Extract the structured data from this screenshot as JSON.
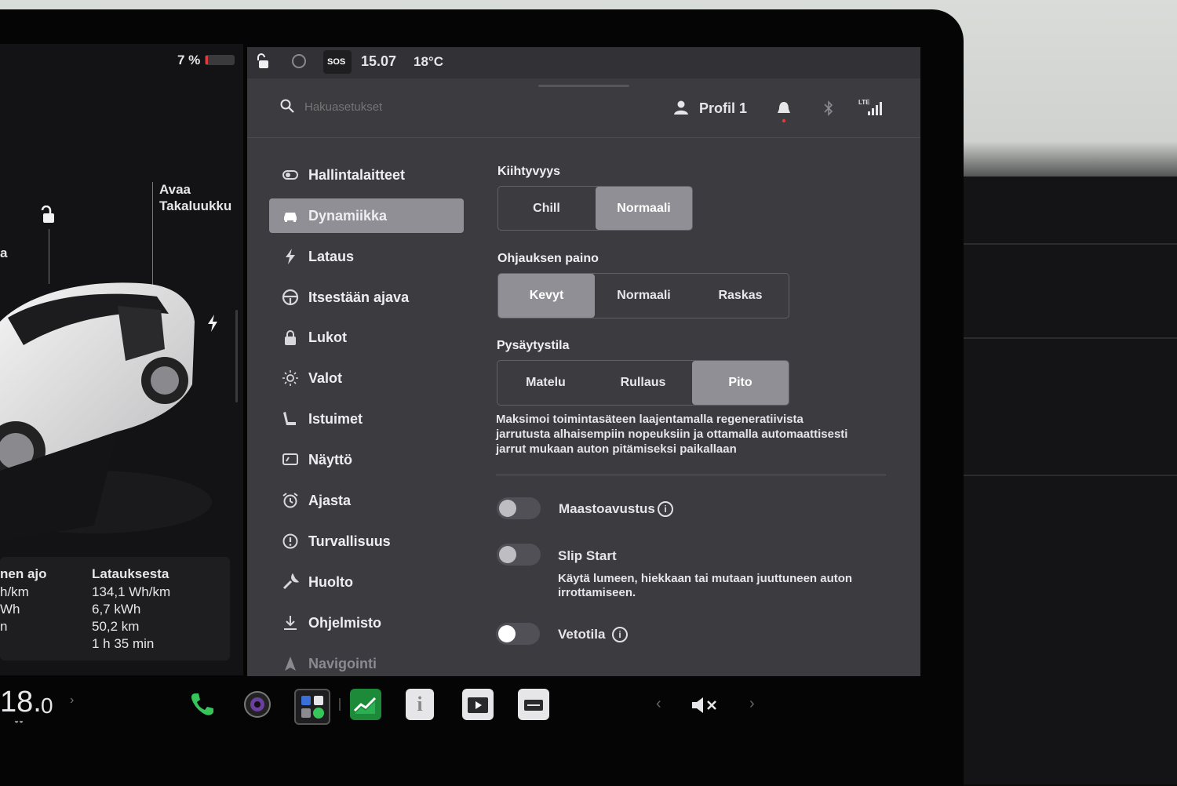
{
  "status": {
    "battery_percent": "7 %",
    "battery_level": 0.07,
    "sos_label": "SOS",
    "time": "15.07",
    "temperature": "18°C"
  },
  "car_panel": {
    "trunk_label_line1": "Avaa",
    "trunk_label_line2": "Takaluukku",
    "left_edge_letter": "a",
    "stats_left_header": "nen ajo",
    "stats_left_values": [
      "h/km",
      "Wh",
      "n"
    ],
    "stats_right_header": "Latauksesta",
    "stats_right_values": [
      "134,1 Wh/km",
      "6,7 kWh",
      "50,2 km",
      "1 h 35 min"
    ]
  },
  "header": {
    "search_placeholder": "Hakuasetukset",
    "profile_label": "Profil 1",
    "network_label": "LTE"
  },
  "sidebar": {
    "items": [
      {
        "label": "Hallintalaitteet",
        "icon": "toggle-icon"
      },
      {
        "label": "Dynamiikka",
        "icon": "car-icon",
        "active": true
      },
      {
        "label": "Lataus",
        "icon": "bolt-icon"
      },
      {
        "label": "Itsestään ajava",
        "icon": "steering-wheel-icon"
      },
      {
        "label": "Lukot",
        "icon": "lock-icon"
      },
      {
        "label": "Valot",
        "icon": "sun-icon"
      },
      {
        "label": "Istuimet",
        "icon": "seat-icon"
      },
      {
        "label": "Näyttö",
        "icon": "display-icon"
      },
      {
        "label": "Ajasta",
        "icon": "alarm-clock-icon"
      },
      {
        "label": "Turvallisuus",
        "icon": "info-circle-icon"
      },
      {
        "label": "Huolto",
        "icon": "wrench-icon"
      },
      {
        "label": "Ohjelmisto",
        "icon": "download-icon"
      },
      {
        "label": "Navigointi",
        "icon": "navigation-icon"
      }
    ]
  },
  "dynamics": {
    "acceleration": {
      "title": "Kiihtyvyys",
      "options": [
        "Chill",
        "Normaali"
      ],
      "selected": "Normaali"
    },
    "steering": {
      "title": "Ohjauksen paino",
      "options": [
        "Kevyt",
        "Normaali",
        "Raskas"
      ],
      "selected": "Kevyt"
    },
    "stop_mode": {
      "title": "Pysäytystila",
      "options": [
        "Matelu",
        "Rullaus",
        "Pito"
      ],
      "selected": "Pito",
      "description_lines": [
        "Maksimoi toimintasäteen laajentamalla regeneratiivista",
        "jarrutusta alhaisempiin nopeuksiin ja ottamalla automaattisesti",
        "jarrut mukaan auton pitämiseksi paikallaan"
      ]
    },
    "toggles": [
      {
        "label": "Maastoavustus",
        "on": false,
        "has_info": true
      },
      {
        "label": "Slip Start",
        "on": false,
        "has_info": false,
        "description_lines": [
          "Käytä lumeen, hiekkaan tai mutaan juuttuneen auton",
          "irrottamiseen."
        ]
      },
      {
        "label": "Vetotila",
        "on": false,
        "has_info": true
      }
    ]
  },
  "dock": {
    "cabin_temp_whole": "18.",
    "cabin_temp_decimal": "0",
    "icons": [
      "phone-icon",
      "camera-icon",
      "apps-icon",
      "energy-chart-icon",
      "manual-icon",
      "theater-icon",
      "arcade-icon"
    ],
    "volume_icon": "volume-muted-icon",
    "prev_label": "‹",
    "next_label": "›"
  },
  "colors": {
    "panel": "#3b3b40",
    "active": "#8f8f95",
    "battery_low": "#e03a3a",
    "phone_green": "#37c45a",
    "notification_red": "#e03a3a"
  }
}
